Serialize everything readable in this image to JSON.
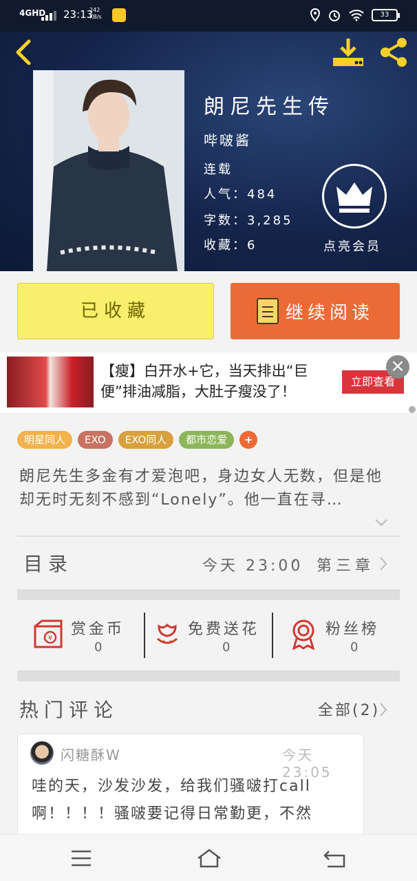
{
  "status_bar": {
    "network": "4GHD",
    "time": "23:13",
    "speed": "242 KB/s",
    "battery": "33"
  },
  "header": {
    "icons": [
      "back-icon",
      "download-icon",
      "share-icon",
      "crown-icon"
    ],
    "title": "朗尼先生传",
    "author": "哔啵酱",
    "status": "连载",
    "popularity_label": "人气：",
    "popularity": "484",
    "words_label": "字数：",
    "words": "3,285",
    "favorites_label": "收藏：",
    "favorites": "6",
    "vip_label": "点亮会员"
  },
  "actions": {
    "favorite_label": "已收藏",
    "read_label": "继续阅读"
  },
  "ad": {
    "text": "【瘦】白开水+它，当天排出“巨便”排油减脂，大肚子瘦没了！",
    "cta": "立即查看",
    "close": "×"
  },
  "tags": [
    {
      "label": "明星同人",
      "color": "#f4b24c"
    },
    {
      "label": "EXO",
      "color": "#c97262"
    },
    {
      "label": "EXO同人",
      "color": "#d8a03e"
    },
    {
      "label": "都市恋爱",
      "color": "#8db65a"
    },
    {
      "label": "+",
      "color": "#ec6a36"
    }
  ],
  "description": "朗尼先生多金有才爱泡吧，身边女人无数，但是他却无时无刻不感到“Lonely”。他一直在寻…",
  "toc": {
    "label": "目录",
    "time": "今天 23:00",
    "dot": "·",
    "chapter": "第三章"
  },
  "stats": [
    {
      "label": "赏金币",
      "value": "0",
      "icon": "money-envelope-icon"
    },
    {
      "label": "免费送花",
      "value": "0",
      "icon": "flower-icon"
    },
    {
      "label": "粉丝榜",
      "value": "0",
      "icon": "medal-icon"
    }
  ],
  "comments_section": {
    "label": "热门评论",
    "all": "全部(2)"
  },
  "comment": {
    "user": "闪糖酥W",
    "time": "今天 23:05",
    "text": "哇的天，沙发沙发，给我们骚啵打call啊！！！！骚啵要记得日常勤更，不然"
  },
  "colors": {
    "accent_orange": "#ec6a36",
    "favorite_yellow": "#f8ef6c",
    "icon_yellow": "#f7d02c",
    "stat_red": "#d0382f",
    "header_dark": "#14244a"
  },
  "navbar": {
    "icons": [
      "menu-icon",
      "home-icon",
      "back-nav-icon"
    ]
  }
}
